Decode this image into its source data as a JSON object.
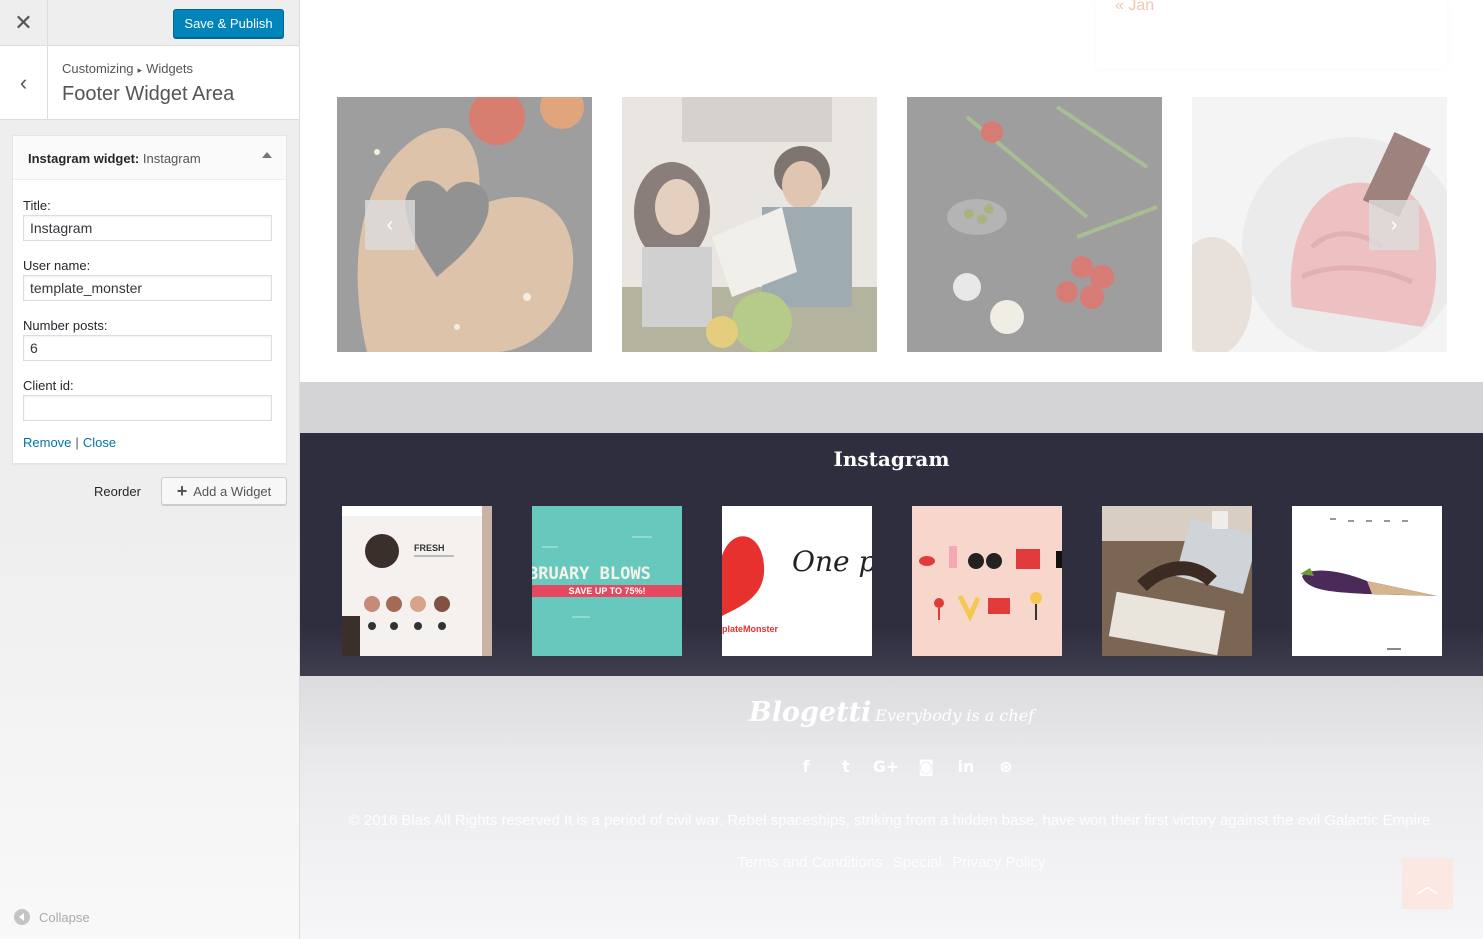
{
  "topbar": {
    "close_icon": "close-icon",
    "publish_label": "Save & Publish"
  },
  "section": {
    "breadcrumb_root": "Customizing",
    "breadcrumb_child": "Widgets",
    "title": "Footer Widget Area"
  },
  "widget": {
    "type_label": "Instagram widget:",
    "instance_title": "Instagram",
    "fields": {
      "title": {
        "label": "Title:",
        "value": "Instagram"
      },
      "username": {
        "label": "User name:",
        "value": "template_monster"
      },
      "number_posts": {
        "label": "Number posts:",
        "value": "6"
      },
      "client_id": {
        "label": "Client id:",
        "value": ""
      }
    },
    "remove_label": "Remove",
    "separator": "|",
    "close_label": "Close"
  },
  "actions": {
    "reorder_label": "Reorder",
    "add_widget_label": "Add a Widget"
  },
  "collapse_label": "Collapse",
  "preview": {
    "calendar_prev": "« Jan",
    "footer_widget_title": "Instagram",
    "instagram_posts": [
      {
        "text": "FRESH"
      },
      {
        "text": "BRUARY BLOWS",
        "subtext": "SAVE UP TO 75%!"
      },
      {
        "text": "One pr one lo",
        "subtext": "plateMonster"
      },
      {
        "text": ""
      },
      {
        "text": ""
      },
      {
        "text": ""
      }
    ],
    "brand_name": "Blogetti",
    "brand_tagline": "Everybody is a chef",
    "social_icons": [
      "facebook-icon",
      "twitter-icon",
      "google-plus-icon",
      "instagram-icon",
      "linkedin-icon",
      "dribbble-icon"
    ],
    "social_glyphs": [
      "f",
      "t",
      "G+",
      "◙",
      "in",
      "⊛"
    ],
    "copyright": "© 2016 Blas All Rights reserved It is a period of civil war. Rebel spaceships, striking from a hidden base, have won their first victory against the evil Galactic Empire.",
    "links": [
      "Terms and Conditions",
      "Special",
      "Privacy Policy"
    ]
  },
  "colors": {
    "primary_button": "#0085ba",
    "link": "#0073aa",
    "footer_dark": "#2f2e3f",
    "accent_peach": "#f1c7b2"
  }
}
